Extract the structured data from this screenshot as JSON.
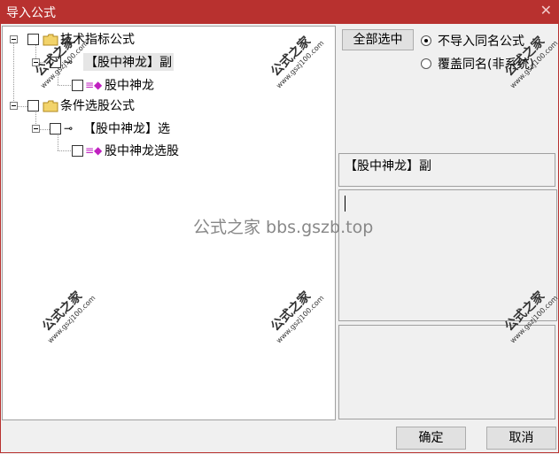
{
  "window": {
    "title": "导入公式",
    "close_glyph": "✕"
  },
  "tree": {
    "nodes": [
      {
        "label": "技术指标公式"
      },
      {
        "label": "【股中神龙】副"
      },
      {
        "label": "股中神龙"
      },
      {
        "label": "条件选股公式"
      },
      {
        "label": "【股中神龙】选"
      },
      {
        "label": "股中神龙选股"
      }
    ]
  },
  "right_panel": {
    "select_all_label": "全部选中",
    "options": [
      {
        "label": "不导入同名公式",
        "selected": true
      },
      {
        "label": "覆盖同名(非系统)",
        "selected": false
      }
    ],
    "selected_formula_name": "【股中神龙】副"
  },
  "footer": {
    "ok_label": "确定",
    "cancel_label": "取消"
  },
  "watermark": {
    "text": "公式之家 bbs.gszb.top",
    "stamp_cn": "公式之家",
    "stamp_url": "www.gszj100.com"
  },
  "colors": {
    "titlebar": "#b8312f",
    "accent": "#c020c0"
  }
}
